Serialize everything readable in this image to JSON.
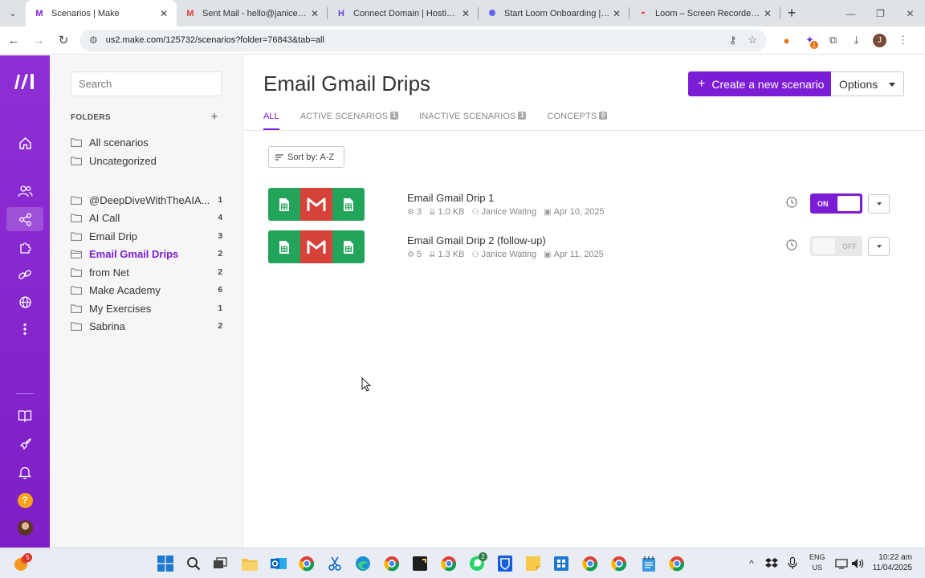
{
  "browser": {
    "tabs": [
      {
        "title": "Scenarios | Make",
        "favicon": "make-icon",
        "active": true
      },
      {
        "title": "Sent Mail - hello@janicemw.co",
        "favicon": "gmail-icon",
        "active": false
      },
      {
        "title": "Connect Domain | Hostinger",
        "favicon": "hostinger-icon",
        "active": false
      },
      {
        "title": "Start Loom Onboarding | Loom",
        "favicon": "loom-icon",
        "active": false
      },
      {
        "title": "Loom – Screen Recorder & Scr",
        "favicon": "loom-color-icon",
        "active": false
      }
    ],
    "url": "us2.make.com/125732/scenarios?folder=76843&tab=all",
    "profile_initial": "J",
    "extension_badge": "1"
  },
  "search": {
    "placeholder": "Search"
  },
  "folders": {
    "heading": "FOLDERS",
    "base": [
      {
        "name": "All scenarios"
      },
      {
        "name": "Uncategorized"
      }
    ],
    "items": [
      {
        "name": "@DeepDiveWithTheAIA...",
        "count": "1"
      },
      {
        "name": "AI Call",
        "count": "4"
      },
      {
        "name": "Email Drip",
        "count": "3"
      },
      {
        "name": "Email Gmail Drips",
        "count": "2",
        "active": true
      },
      {
        "name": "from Net",
        "count": "2"
      },
      {
        "name": "Make Academy",
        "count": "6"
      },
      {
        "name": "My Exercises",
        "count": "1"
      },
      {
        "name": "Sabrina",
        "count": "2"
      }
    ]
  },
  "main": {
    "title": "Email Gmail Drips",
    "create_label": "Create a new scenario",
    "options_label": "Options",
    "tabs": [
      {
        "label": "ALL",
        "count": null
      },
      {
        "label": "ACTIVE SCENARIOS",
        "count": "1"
      },
      {
        "label": "INACTIVE SCENARIOS",
        "count": "1"
      },
      {
        "label": "CONCEPTS",
        "count": "0"
      }
    ],
    "sort_label": "Sort by: A-Z",
    "scenarios": [
      {
        "name": "Email Gmail Drip 1",
        "modules": "3",
        "size": "1.0 KB",
        "owner": "Janice Wating",
        "date": "Apr 10, 2025",
        "status": "ON"
      },
      {
        "name": "Email Gmail Drip 2 (follow-up)",
        "modules": "5",
        "size": "1.3 KB",
        "owner": "Janice Wating",
        "date": "Apr 11, 2025",
        "status": "OFF"
      }
    ]
  },
  "taskbar": {
    "weather_badge": "5",
    "whatsapp_badge": "2",
    "language": "ENG",
    "region": "US",
    "time": "10:22 am",
    "date": "11/04/2025"
  },
  "colors": {
    "brand": "#7c1dd6",
    "rail": "#8e2fd6",
    "sheets_green": "#22a45a",
    "gmail_red": "#d6413a"
  }
}
